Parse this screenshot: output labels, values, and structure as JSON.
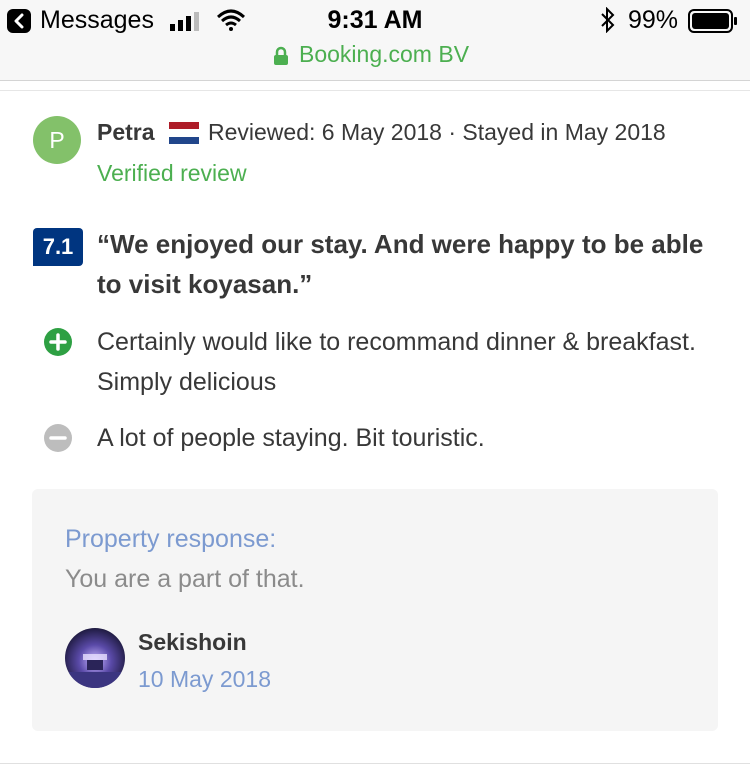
{
  "status_bar": {
    "back_label": "Messages",
    "time": "9:31 AM",
    "battery": "99%"
  },
  "address_bar": {
    "site": "Booking.com BV"
  },
  "review": {
    "avatar_initial": "P",
    "reviewer_name": "Petra",
    "flag_icon": "netherlands-flag-icon",
    "meta": "Reviewed: 6 May 2018 · Stayed in May 2018",
    "verified": "Verified review",
    "score": "7.1",
    "title": "“We enjoyed our stay. And were happy to be able to visit koyasan.”",
    "pro": "Certainly would like to recommand dinner & breakfast. Simply delicious",
    "con": "A lot of people staying. Bit touristic."
  },
  "response": {
    "label": "Property response:",
    "text": "You are a part of that.",
    "property_name": "Sekishoin",
    "date": "10 May 2018"
  },
  "colors": {
    "score_badge": "#003580",
    "green": "#4caf50",
    "response_accent": "#7c9ad0",
    "avatar": "#83c16a"
  }
}
